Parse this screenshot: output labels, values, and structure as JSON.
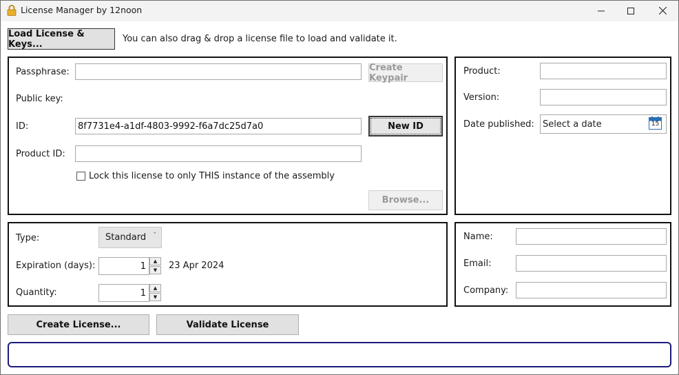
{
  "window": {
    "title": "License Manager by 12noon",
    "minimize_icon": "minimize-icon",
    "maximize_icon": "maximize-icon",
    "close_icon": "close-icon"
  },
  "toolbar": {
    "load_label": "Load License & Keys...",
    "hint": "You can also drag & drop a license file to load and validate it."
  },
  "keys_panel": {
    "passphrase_label": "Passphrase:",
    "passphrase_value": "",
    "create_keypair_label": "Create Keypair",
    "public_key_label": "Public key:",
    "id_label": "ID:",
    "id_value": "8f7731e4-a1df-4803-9992-f6a7dc25d7a0",
    "new_id_label": "New ID",
    "product_id_label": "Product ID:",
    "product_id_value": "",
    "lock_label": "Lock this license to only THIS instance of the assembly",
    "browse_label": "Browse..."
  },
  "product_panel": {
    "product_label": "Product:",
    "product_value": "",
    "version_label": "Version:",
    "version_value": "",
    "date_published_label": "Date published:",
    "date_placeholder": "Select a date",
    "calendar_day": "15"
  },
  "license_panel": {
    "type_label": "Type:",
    "type_value": "Standard",
    "expiration_label": "Expiration (days):",
    "expiration_value": "1",
    "expiration_date": "23 Apr 2024",
    "quantity_label": "Quantity:",
    "quantity_value": "1"
  },
  "customer_panel": {
    "name_label": "Name:",
    "name_value": "",
    "email_label": "Email:",
    "email_value": "",
    "company_label": "Company:",
    "company_value": ""
  },
  "actions": {
    "create_license_label": "Create License...",
    "validate_license_label": "Validate License"
  },
  "status": {
    "text": ""
  },
  "colors": {
    "panel_border": "#111111",
    "status_border": "#1a1a7a",
    "button_face": "#e1e1e1"
  }
}
